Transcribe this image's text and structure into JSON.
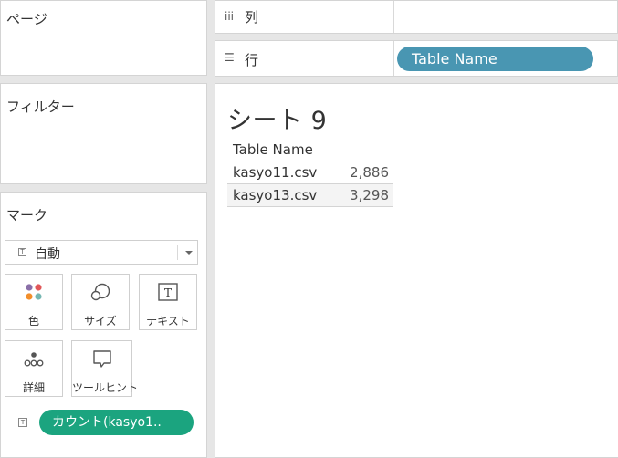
{
  "panels": {
    "pages_title": "ページ",
    "filters_title": "フィルター",
    "marks_title": "マーク"
  },
  "marks": {
    "type_label": "自動",
    "cards": [
      {
        "label": "色",
        "icon": "color-dots-icon"
      },
      {
        "label": "サイズ",
        "icon": "size-circles-icon"
      },
      {
        "label": "テキスト",
        "icon": "text-t-icon"
      },
      {
        "label": "詳細",
        "icon": "detail-dots-icon"
      },
      {
        "label": "ツールヒント",
        "icon": "tooltip-bubble-icon"
      }
    ],
    "field_pill": "カウント(kasyo1.."
  },
  "shelves": {
    "columns_label": "列",
    "rows_label": "行",
    "rows_pill": "Table Name"
  },
  "canvas": {
    "sheet_title": "シート 9",
    "table": {
      "header": "Table Name",
      "rows": [
        {
          "name": "kasyo11.csv",
          "value": "2,886"
        },
        {
          "name": "kasyo13.csv",
          "value": "3,298"
        }
      ]
    }
  },
  "colors": {
    "dimension_pill": "#4996b2",
    "measure_pill": "#1ba47f"
  }
}
